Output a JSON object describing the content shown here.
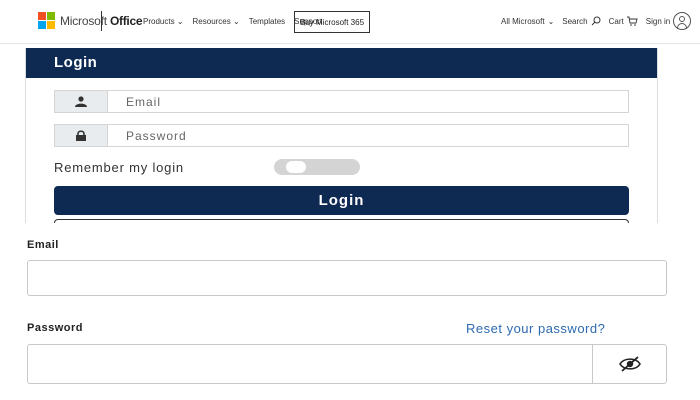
{
  "nav": {
    "brand": "Microsoft",
    "product": "Office",
    "links": [
      "Products",
      "Resources",
      "Templates",
      "Support"
    ],
    "buy_label": "Buy Microsoft 365",
    "all_microsoft": "All Microsoft",
    "search": "Search",
    "cart": "Cart",
    "sign_in": "Sign in",
    "logo_colors": [
      "#f25022",
      "#7fba00",
      "#00a4ef",
      "#ffb900"
    ]
  },
  "login_card": {
    "title": "Login",
    "email_placeholder": "Email",
    "password_placeholder": "Password",
    "remember_label": "Remember my login",
    "remember_on": false,
    "button_label": "Login",
    "header_color": "#0e2a52"
  },
  "lower_form": {
    "email_label": "Email",
    "password_label": "Password",
    "reset_link": "Reset your password?",
    "email_value": "",
    "password_value": "",
    "link_color": "#2d6ab0"
  }
}
